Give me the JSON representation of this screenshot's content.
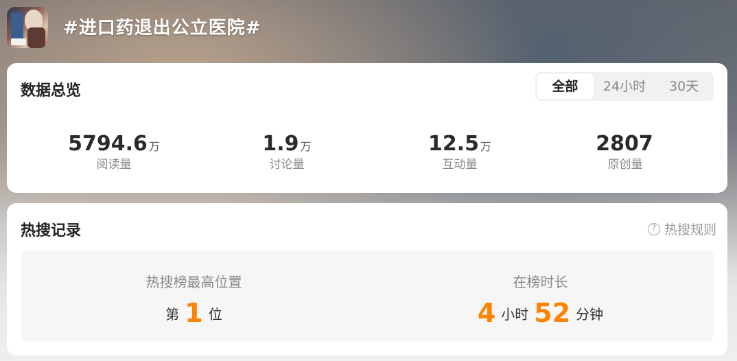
{
  "topic": {
    "title": "#进口药退出公立医院#"
  },
  "overview": {
    "title": "数据总览",
    "tabs": [
      {
        "label": "全部",
        "active": true
      },
      {
        "label": "24小时",
        "active": false
      },
      {
        "label": "30天",
        "active": false
      }
    ],
    "stats": [
      {
        "value": "5794.6",
        "unit": "万",
        "label": "阅读量"
      },
      {
        "value": "1.9",
        "unit": "万",
        "label": "讨论量"
      },
      {
        "value": "12.5",
        "unit": "万",
        "label": "互动量"
      },
      {
        "value": "2807",
        "unit": "",
        "label": "原创量"
      }
    ]
  },
  "hotsearch": {
    "title": "热搜记录",
    "rules_label": "热搜规则",
    "highest": {
      "label": "热搜榜最高位置",
      "prefix": "第",
      "value": "1",
      "suffix": "位"
    },
    "duration": {
      "label": "在榜时长",
      "hours": "4",
      "hours_unit": "小时",
      "minutes": "52",
      "minutes_unit": "分钟"
    }
  },
  "colors": {
    "accent": "#ff8200",
    "card_bg": "#ffffff",
    "panel_bg": "#f6f6f6"
  },
  "icons": {
    "rules": "question-circle-icon"
  }
}
